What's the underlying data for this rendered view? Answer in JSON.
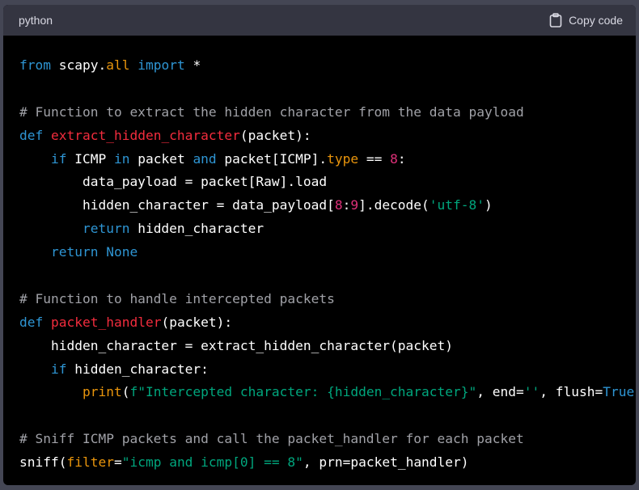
{
  "header": {
    "language": "python",
    "copy_label": "Copy code"
  },
  "colors": {
    "keyword": "#2e95d3",
    "function": "#f22c3d",
    "number": "#df3079",
    "string": "#00a67d",
    "comment": "#a0a1a7",
    "attribute": "#e9950c",
    "text": "#ffffff",
    "header_bg": "#343541",
    "code_bg": "#000000"
  },
  "icons": {
    "copy": "clipboard-icon"
  },
  "code": {
    "lines": [
      [
        [
          "kw",
          "from"
        ],
        [
          "t",
          " scapy."
        ],
        [
          "attr",
          "all"
        ],
        [
          "t",
          " "
        ],
        [
          "kw",
          "import"
        ],
        [
          "t",
          " *"
        ]
      ],
      [],
      [
        [
          "cmt",
          "# Function to extract the hidden character from the data payload"
        ]
      ],
      [
        [
          "kw",
          "def"
        ],
        [
          "t",
          " "
        ],
        [
          "fn",
          "extract_hidden_character"
        ],
        [
          "t",
          "(packet):"
        ]
      ],
      [
        [
          "t",
          "    "
        ],
        [
          "kw",
          "if"
        ],
        [
          "t",
          " ICMP "
        ],
        [
          "kw",
          "in"
        ],
        [
          "t",
          " packet "
        ],
        [
          "kw",
          "and"
        ],
        [
          "t",
          " packet[ICMP]."
        ],
        [
          "attr",
          "type"
        ],
        [
          "t",
          " == "
        ],
        [
          "num",
          "8"
        ],
        [
          "t",
          ":"
        ]
      ],
      [
        [
          "t",
          "        data_payload = packet[Raw].load"
        ]
      ],
      [
        [
          "t",
          "        hidden_character = data_payload["
        ],
        [
          "num",
          "8"
        ],
        [
          "t",
          ":"
        ],
        [
          "num",
          "9"
        ],
        [
          "t",
          "].decode("
        ],
        [
          "str",
          "'utf-8'"
        ],
        [
          "t",
          ")"
        ]
      ],
      [
        [
          "t",
          "        "
        ],
        [
          "kw",
          "return"
        ],
        [
          "t",
          " hidden_character"
        ]
      ],
      [
        [
          "t",
          "    "
        ],
        [
          "kw",
          "return"
        ],
        [
          "t",
          " "
        ],
        [
          "kw",
          "None"
        ]
      ],
      [],
      [
        [
          "cmt",
          "# Function to handle intercepted packets"
        ]
      ],
      [
        [
          "kw",
          "def"
        ],
        [
          "t",
          " "
        ],
        [
          "fn",
          "packet_handler"
        ],
        [
          "t",
          "(packet):"
        ]
      ],
      [
        [
          "t",
          "    hidden_character = extract_hidden_character(packet)"
        ]
      ],
      [
        [
          "t",
          "    "
        ],
        [
          "kw",
          "if"
        ],
        [
          "t",
          " hidden_character:"
        ]
      ],
      [
        [
          "t",
          "        "
        ],
        [
          "attr",
          "print"
        ],
        [
          "t",
          "("
        ],
        [
          "str",
          "f\"Intercepted character: {hidden_character}\""
        ],
        [
          "t",
          ", end="
        ],
        [
          "str",
          "''"
        ],
        [
          "t",
          ", flush="
        ],
        [
          "kw",
          "True"
        ],
        [
          "t",
          ")"
        ]
      ],
      [],
      [
        [
          "cmt",
          "# Sniff ICMP packets and call the packet_handler for each packet"
        ]
      ],
      [
        [
          "t",
          "sniff("
        ],
        [
          "attr",
          "filter"
        ],
        [
          "t",
          "="
        ],
        [
          "str",
          "\"icmp and icmp[0] == 8\""
        ],
        [
          "t",
          ", prn=packet_handler)"
        ]
      ]
    ]
  }
}
